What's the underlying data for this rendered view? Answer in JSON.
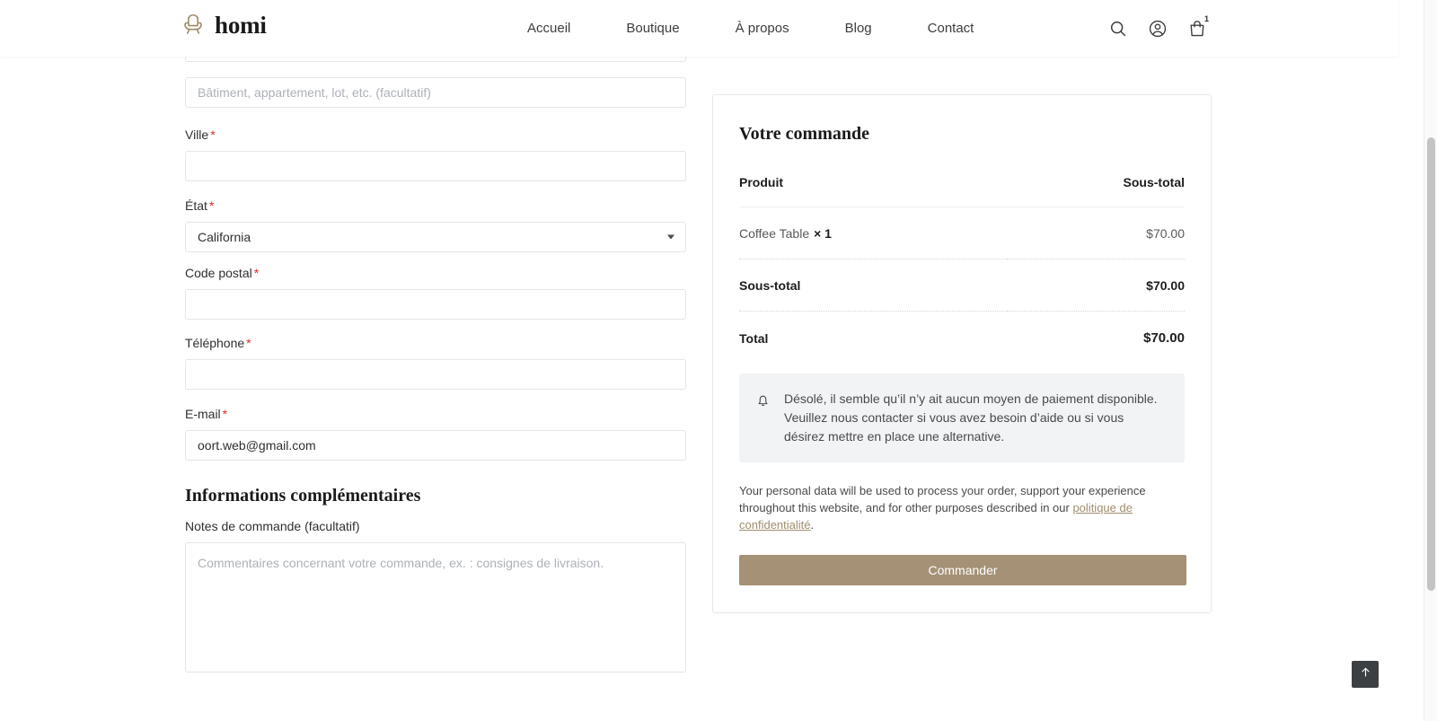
{
  "header": {
    "brand": {
      "name": "homi",
      "logo_icon": "armchair-icon",
      "logo_color": "#a08a68"
    },
    "nav": [
      {
        "label": "Accueil"
      },
      {
        "label": "Boutique"
      },
      {
        "label": "À propos"
      },
      {
        "label": "Blog"
      },
      {
        "label": "Contact"
      }
    ],
    "actions": {
      "search_icon": "search-icon",
      "account_icon": "user-circle-icon",
      "cart_icon": "shopping-bag-icon",
      "cart_count": "1"
    }
  },
  "billing": {
    "address2": {
      "placeholder": "Bâtiment, appartement, lot, etc. (facultatif)",
      "value": ""
    },
    "city": {
      "label": "Ville",
      "required": "*",
      "value": ""
    },
    "state": {
      "label": "État",
      "required": "*",
      "value": "California"
    },
    "postcode": {
      "label": "Code postal",
      "required": "*",
      "value": ""
    },
    "phone": {
      "label": "Téléphone",
      "required": "*",
      "value": ""
    },
    "email": {
      "label": "E-mail",
      "required": "*",
      "value": "oort.web@gmail.com"
    }
  },
  "additional": {
    "heading": "Informations complémentaires",
    "notes_label": "Notes de commande (facultatif)",
    "notes_placeholder": "Commentaires concernant votre commande, ex. : consignes de livraison.",
    "notes_value": ""
  },
  "order": {
    "title": "Votre commande",
    "col_product": "Produit",
    "col_subtotal": "Sous-total",
    "items": [
      {
        "name": "Coffee Table",
        "qty": "× 1",
        "amount": "$70.00"
      }
    ],
    "subtotal_label": "Sous-total",
    "subtotal_amount": "$70.00",
    "total_label": "Total",
    "total_amount": "$70.00",
    "notice": {
      "icon": "bell-icon",
      "text": "Désolé, il semble qu’il n’y ait aucun moyen de paiement disponible. Veuillez nous contacter si vous avez besoin d’aide ou si vous désirez mettre en place une alternative."
    },
    "privacy": {
      "text_before": "Your personal data will be used to process your order, support your experience throughout this website, and for other purposes described in our ",
      "link": "politique de confidentialité",
      "text_after": "."
    },
    "place_order_label": "Commander",
    "accent_color": "#a59176"
  },
  "misc": {
    "scroll_top_icon": "arrow-up-icon"
  }
}
